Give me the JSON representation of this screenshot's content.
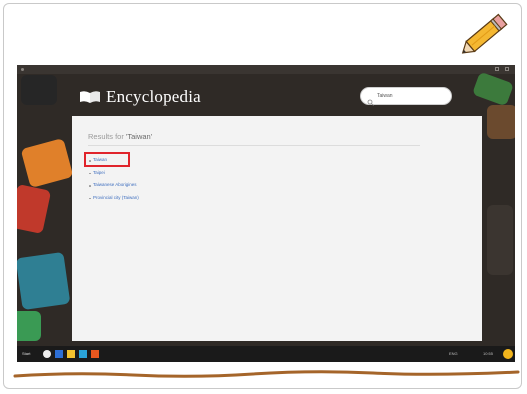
{
  "app": {
    "title": "Encyclopedia",
    "icon": "open-book-icon"
  },
  "search": {
    "value": "Taiwan",
    "icon": "search-icon"
  },
  "results": {
    "prefix": "Results for",
    "query": "'Taiwan'",
    "items": [
      "Taiwan",
      "Taipei",
      "Taiwanese Aborigines",
      "Provincial city (Taiwan)"
    ],
    "highlighted_index": 0
  },
  "taskbar": {
    "start_label": "Start",
    "tray_lang": "ENG",
    "clock": "10:55"
  },
  "colors": {
    "highlight": "#e0242b",
    "link": "#3f6fbf",
    "annotation_line": "#a5652a"
  }
}
